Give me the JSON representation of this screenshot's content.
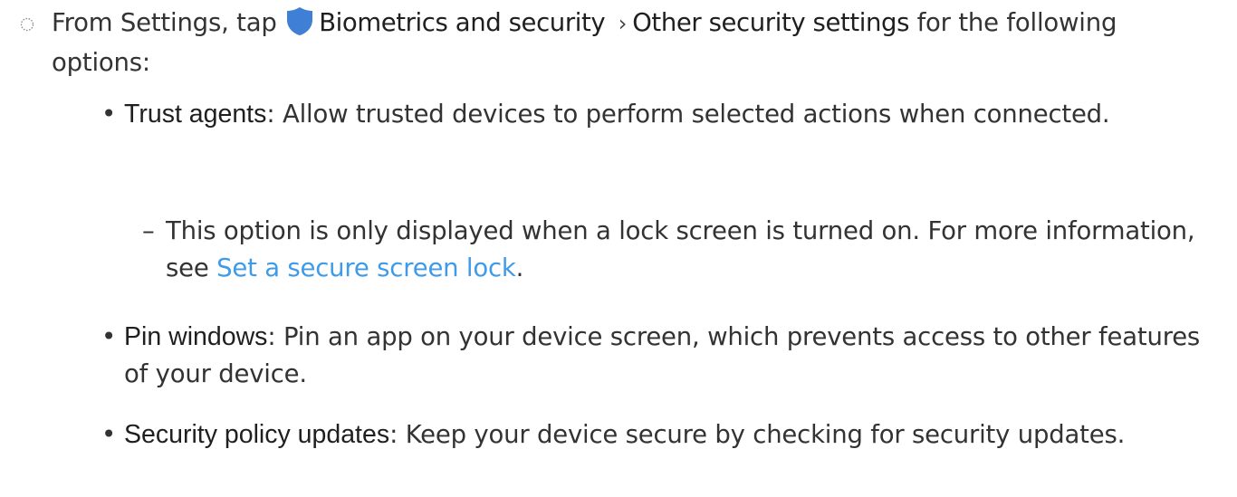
{
  "step": {
    "prefix": "From Settings, tap",
    "menu1": "Biometrics and security",
    "separator": "›",
    "menu2": "Other security settings",
    "suffix": "for the following options:"
  },
  "options": [
    {
      "term": "Trust agents",
      "colon": ":",
      "text": "Allow trusted devices to perform selected actions when connected."
    },
    {
      "term": "Pin windows",
      "colon": ":",
      "text": "Pin an app on your device screen, which prevents access to other features of your device."
    },
    {
      "term": "Security policy updates",
      "colon": ":",
      "text": "Keep your device secure by checking for security updates."
    }
  ],
  "note": {
    "dash": "–",
    "text": "This option is only displayed when a lock screen is turned on. For more information, see",
    "link": "Set a secure screen lock",
    "end": "."
  },
  "icons": {
    "step_bullet": "dotted-circle-icon",
    "menu_icon": "shield-icon"
  },
  "colors": {
    "link": "#3f9be8",
    "shield": "#3f7fd6"
  }
}
